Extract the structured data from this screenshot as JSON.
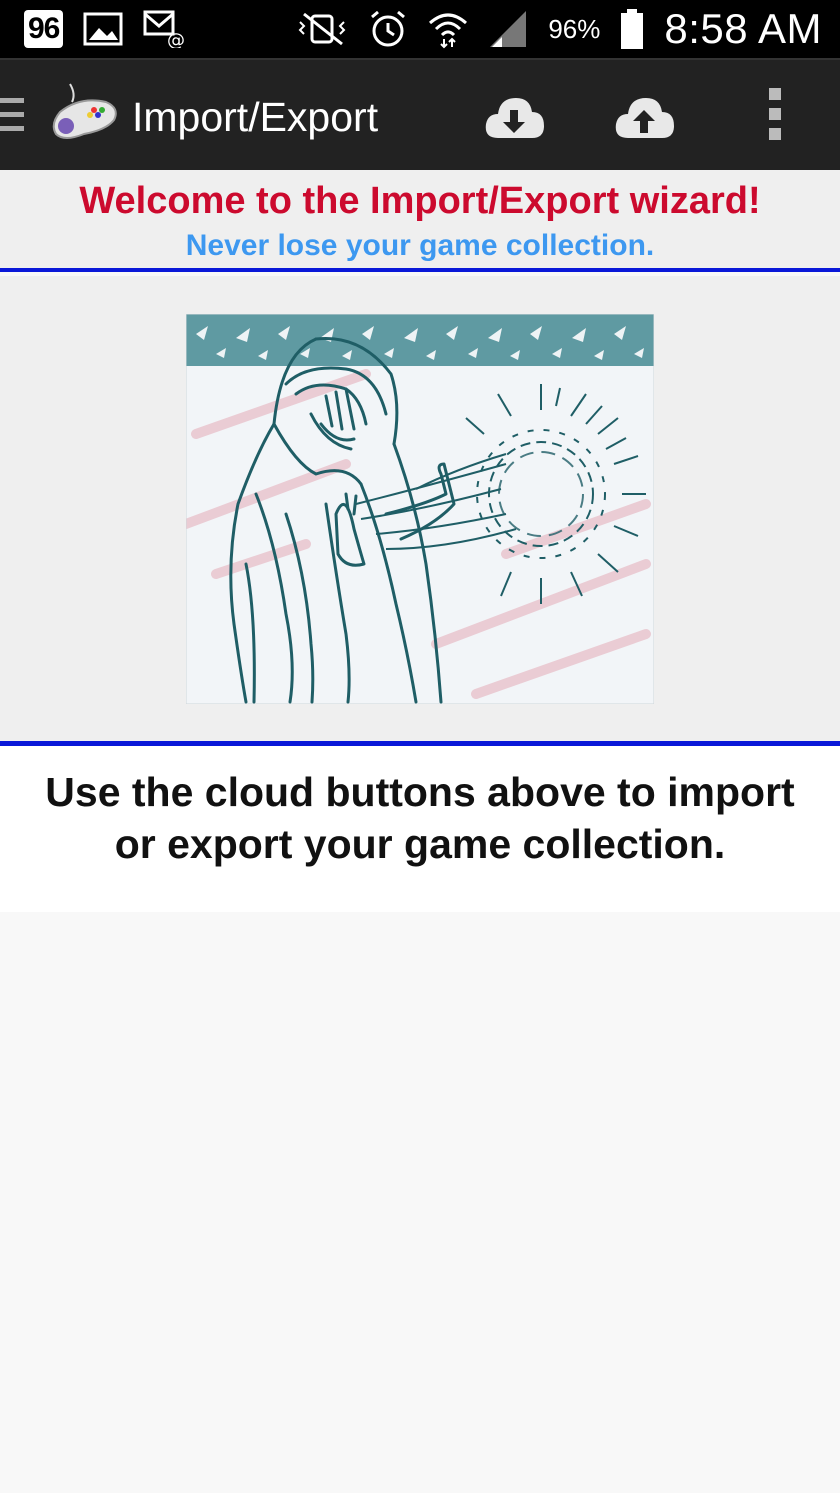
{
  "status_bar": {
    "notification_badge": "96",
    "battery_percent": "96%",
    "time": "8:58 AM",
    "icons": [
      "notification-96-icon",
      "gallery-icon",
      "email-icon",
      "vibrate-mute-icon",
      "alarm-icon",
      "wifi-icon",
      "signal-icon",
      "battery-icon"
    ]
  },
  "action_bar": {
    "title": "Import/Export",
    "app_icon": "gamepad-icon",
    "buttons": [
      "cloud-download-icon",
      "cloud-upload-icon",
      "overflow-menu-icon"
    ],
    "colors": {
      "background": "#222222"
    }
  },
  "header": {
    "welcome": "Welcome to the Import/Export wizard!",
    "tagline": "Never lose your game collection.",
    "colors": {
      "welcome": "#cc0a2e",
      "tagline": "#3d98f0",
      "divider": "#0a18d8"
    }
  },
  "image": {
    "name": "wizard-illustration"
  },
  "instruction": {
    "text": "Use the cloud buttons above to import or export your game collection."
  }
}
